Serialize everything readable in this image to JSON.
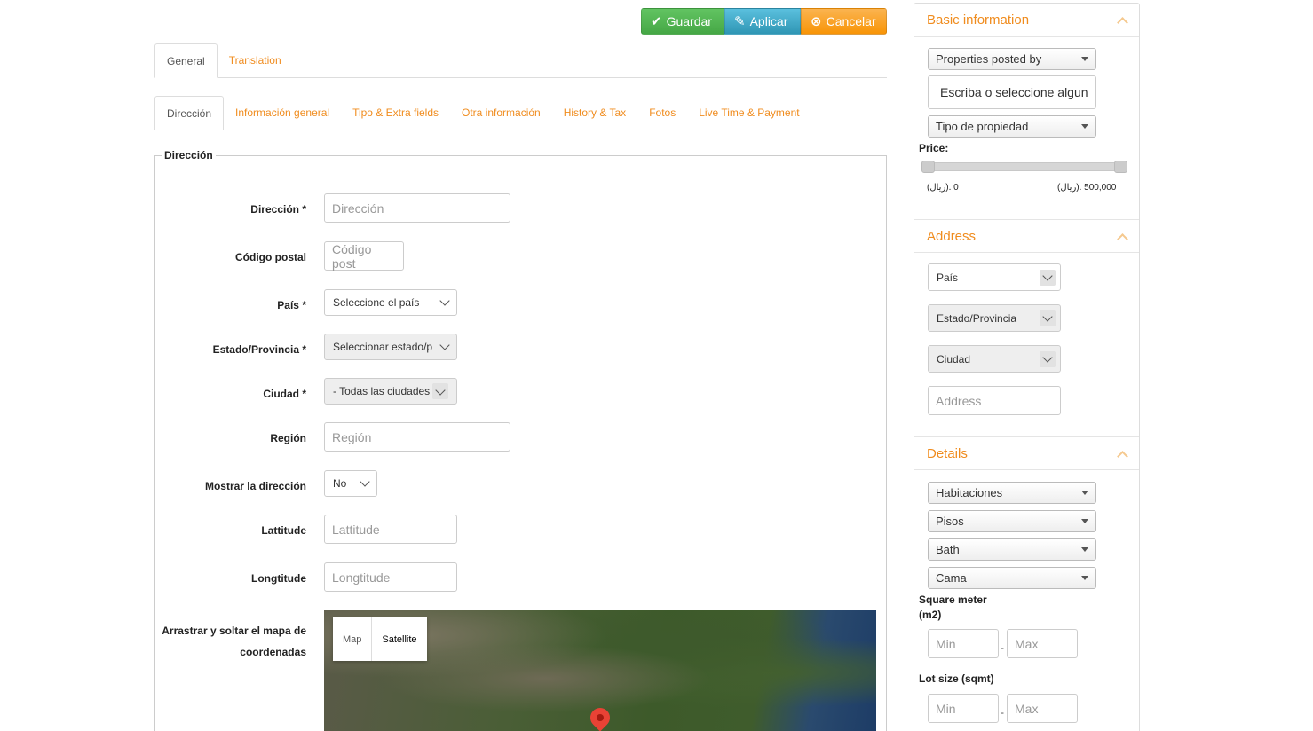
{
  "toolbar": {
    "save": "Guardar",
    "apply": "Aplicar",
    "cancel": "Cancelar"
  },
  "tabs_top": [
    "General",
    "Translation"
  ],
  "tabs_sub": [
    "Dirección",
    "Información general",
    "Tipo & Extra fields",
    "Otra información",
    "History & Tax",
    "Fotos",
    "Live Time & Payment"
  ],
  "form": {
    "legend": "Dirección",
    "address": {
      "label": "Dirección *",
      "placeholder": "Dirección"
    },
    "postal": {
      "label": "Código postal",
      "placeholder": "Código post"
    },
    "country": {
      "label": "País *",
      "value": "Seleccione el país"
    },
    "state": {
      "label": "Estado/Provincia *",
      "value": "Seleccionar estado/p"
    },
    "city": {
      "label": "Ciudad *",
      "value": "- Todas las ciudades"
    },
    "region": {
      "label": "Región",
      "placeholder": "Región"
    },
    "show_address": {
      "label": "Mostrar la dirección",
      "value": "No"
    },
    "lat": {
      "label": "Lattitude",
      "placeholder": "Lattitude"
    },
    "lng": {
      "label": "Longtitude",
      "placeholder": "Longtitude"
    },
    "map_label_1": "Arrastrar y soltar el mapa de",
    "map_label_2": "coordenadas",
    "map_types": [
      "Map",
      "Satellite"
    ]
  },
  "sidebar": {
    "basic": {
      "title": "Basic information",
      "posted_by": "Properties posted by",
      "search_placeholder": "Escriba o seleccione algun",
      "property_type": "Tipo de propiedad",
      "price_label": "Price:",
      "price_min": "(ريال). 0",
      "price_max": "(ريال). 500,000"
    },
    "address": {
      "title": "Address",
      "country": "País",
      "state": "Estado/Provincia",
      "city": "Ciudad",
      "address_placeholder": "Address"
    },
    "details": {
      "title": "Details",
      "rooms": "Habitaciones",
      "floors": "Pisos",
      "bath": "Bath",
      "bed": "Cama",
      "sqm_label_1": "Square meter",
      "sqm_label_2": "(m2)",
      "lot_label": "Lot size (sqmt)",
      "min_placeholder": "Min",
      "max_placeholder": "Max",
      "dash": "-"
    }
  },
  "colors": {
    "accent": "#f08c1e",
    "save": "#45a745",
    "apply": "#2f96b4",
    "cancel": "#f89406"
  }
}
